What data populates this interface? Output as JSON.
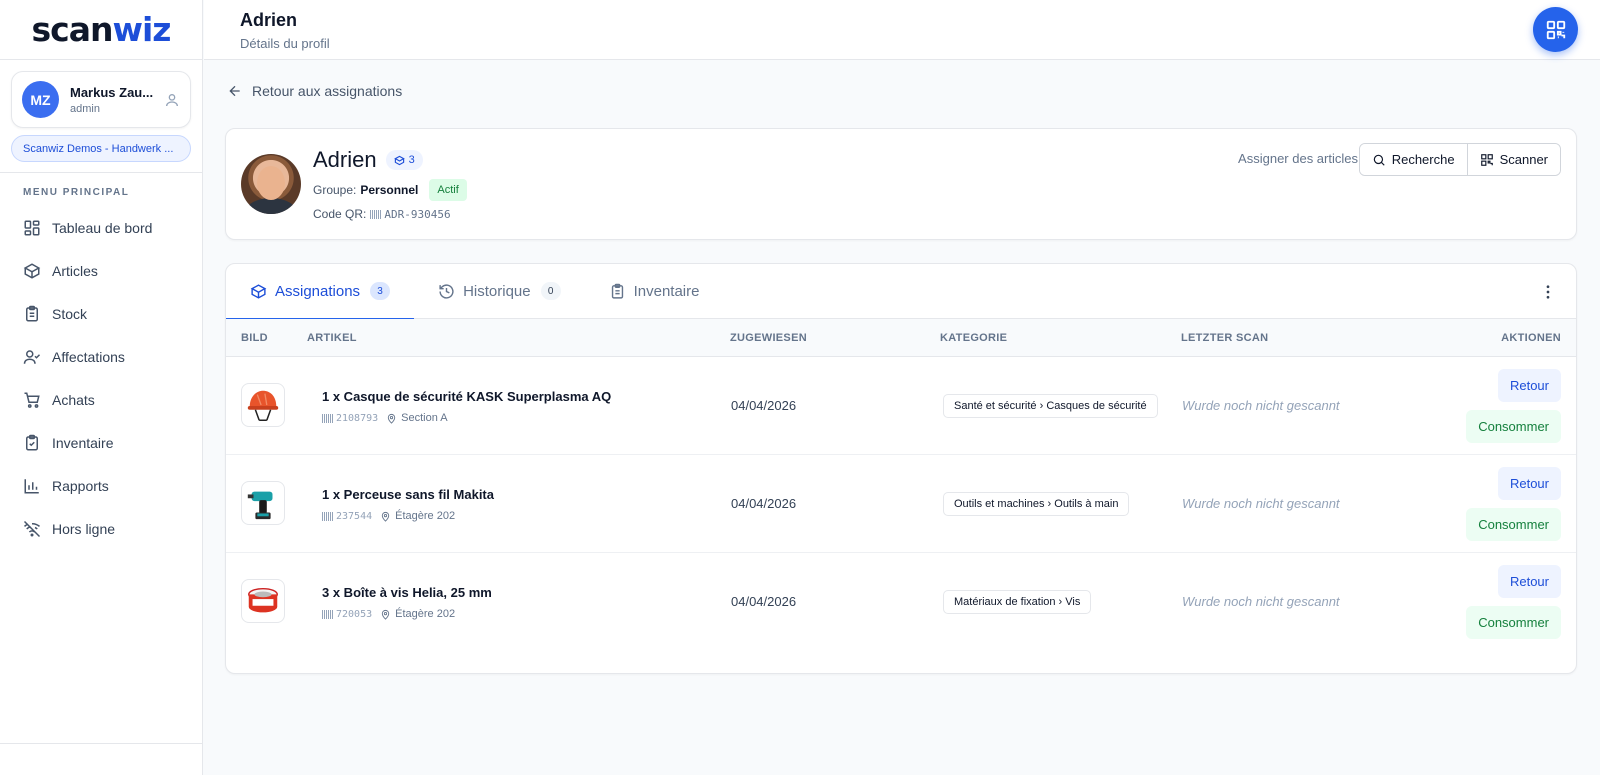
{
  "brand": {
    "logo_part1": "scan",
    "logo_part2": "wiz"
  },
  "user": {
    "initials": "MZ",
    "name": "Markus Zau...",
    "role": "admin",
    "org": "Scanwiz Demos - Handwerk ..."
  },
  "sidebar": {
    "menu_header": "MENU PRINCIPAL",
    "items": [
      {
        "label": "Tableau de bord",
        "icon": "dashboard-icon"
      },
      {
        "label": "Articles",
        "icon": "box-icon"
      },
      {
        "label": "Stock",
        "icon": "clipboard-icon"
      },
      {
        "label": "Affectations",
        "icon": "user-check-icon"
      },
      {
        "label": "Achats",
        "icon": "cart-icon"
      },
      {
        "label": "Inventaire",
        "icon": "clipboard-check-icon"
      },
      {
        "label": "Rapports",
        "icon": "bar-chart-icon"
      },
      {
        "label": "Hors ligne",
        "icon": "wifi-off-icon"
      }
    ]
  },
  "header": {
    "title": "Adrien",
    "subtitle": "Détails du profil",
    "qr_button_icon": "qr-code-icon"
  },
  "back_link": "Retour aux assignations",
  "profile": {
    "name": "Adrien",
    "assigned_count": "3",
    "group_label": "Groupe:",
    "group_value": "Personnel",
    "status": "Actif",
    "qr_label": "Code QR:",
    "qr_code": "ADR-930456",
    "assign_label": "Assigner des articles",
    "search_button": "Recherche",
    "scan_button": "Scanner"
  },
  "tabs": [
    {
      "label": "Assignations",
      "count": "3",
      "active": true
    },
    {
      "label": "Historique",
      "count": "0",
      "active": false
    },
    {
      "label": "Inventaire",
      "count": "",
      "active": false
    }
  ],
  "table": {
    "columns": [
      "BILD",
      "ARTIKEL",
      "ZUGEWIESEN",
      "KATEGORIE",
      "LETZTER SCAN",
      "AKTIONEN"
    ],
    "rows": [
      {
        "name": "1 x Casque de sécurité KASK Superplasma AQ",
        "code": "2108793",
        "location": "Section A",
        "date": "04/04/2026",
        "category": "Santé et sécurité › Casques de sécurité",
        "last_scan": "Wurde noch nicht gescannt",
        "image": "helmet"
      },
      {
        "name": "1 x Perceuse sans fil Makita",
        "code": "237544",
        "location": "Étagère 202",
        "date": "04/04/2026",
        "category": "Outils et machines › Outils à main",
        "last_scan": "Wurde noch nicht gescannt",
        "image": "drill"
      },
      {
        "name": "3 x Boîte à vis Helia, 25 mm",
        "code": "720053",
        "location": "Étagère 202",
        "date": "04/04/2026",
        "category": "Matériaux de fixation › Vis",
        "last_scan": "Wurde noch nicht gescannt",
        "image": "screw-box"
      }
    ],
    "action_return": "Retour",
    "action_consume": "Consommer"
  },
  "colors": {
    "primary": "#2563eb",
    "success": "#15803d",
    "sidebar_bg": "#ffffff",
    "page_bg": "#f8fafc"
  }
}
